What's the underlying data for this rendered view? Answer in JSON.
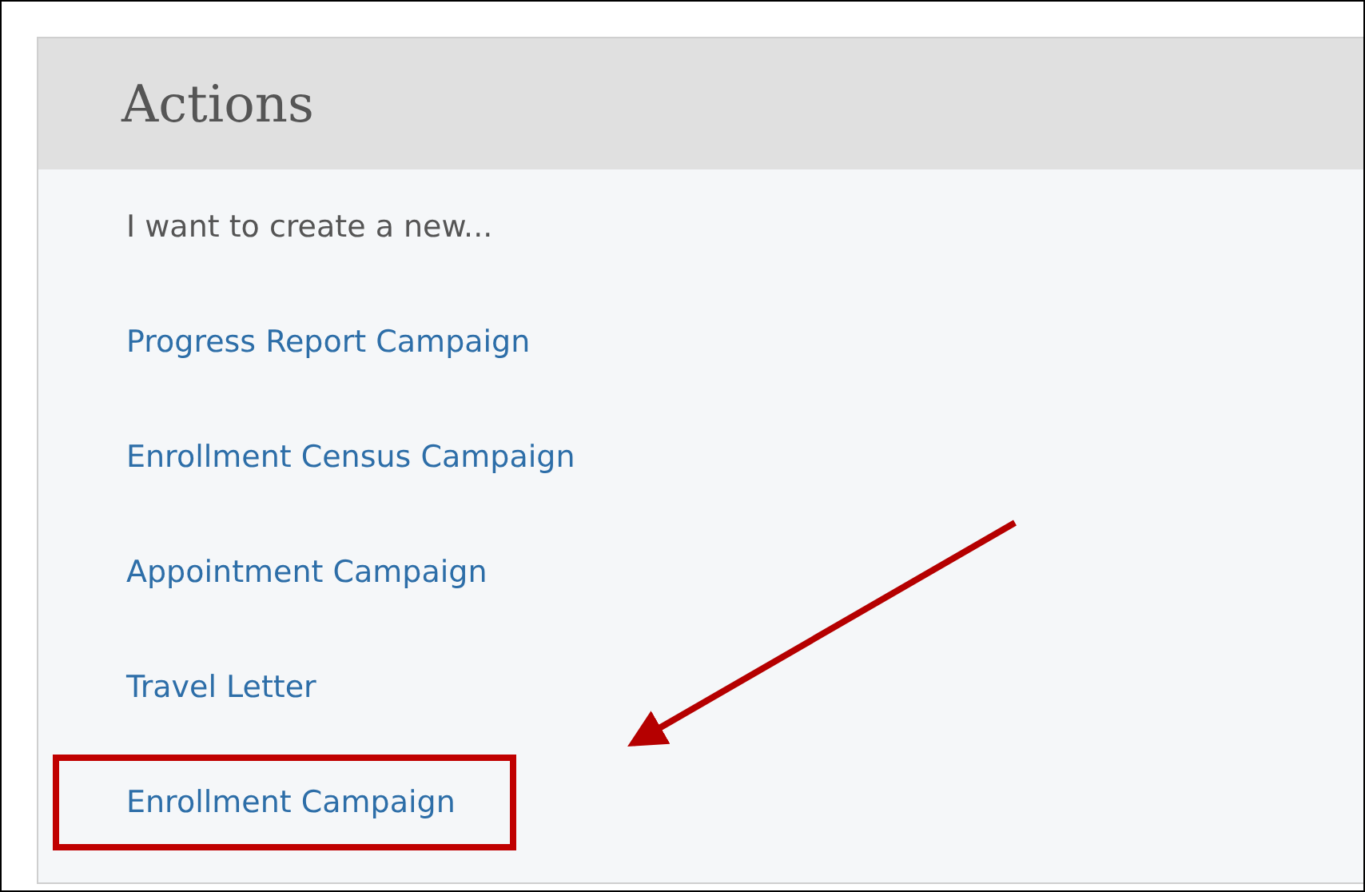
{
  "panel": {
    "title": "Actions",
    "intro": "I want to create a new...",
    "links": [
      {
        "label": "Progress Report Campaign",
        "highlighted": false
      },
      {
        "label": "Enrollment Census Campaign",
        "highlighted": false
      },
      {
        "label": "Appointment Campaign",
        "highlighted": false
      },
      {
        "label": "Travel Letter",
        "highlighted": false
      },
      {
        "label": "Enrollment Campaign",
        "highlighted": true
      }
    ]
  }
}
